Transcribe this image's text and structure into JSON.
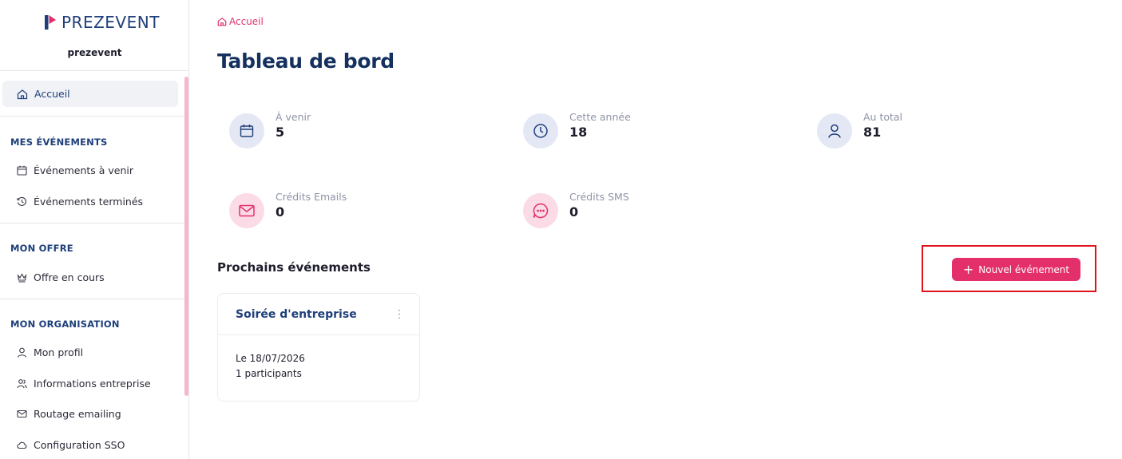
{
  "brand": {
    "name": "PREZEVENT",
    "organization": "prezevent",
    "colors": {
      "navy": "#1e3f7a",
      "accent": "#e3306b"
    }
  },
  "sidebar": {
    "home": {
      "label": "Accueil",
      "icon": "home-icon"
    },
    "sections": [
      {
        "title": "MES ÉVÉNEMENTS",
        "items": [
          {
            "label": "Événements à venir",
            "icon": "calendar-icon"
          },
          {
            "label": "Événements terminés",
            "icon": "history-icon"
          }
        ]
      },
      {
        "title": "MON OFFRE",
        "items": [
          {
            "label": "Offre en cours",
            "icon": "crown-icon"
          }
        ]
      },
      {
        "title": "MON ORGANISATION",
        "items": [
          {
            "label": "Mon profil",
            "icon": "user-icon"
          },
          {
            "label": "Informations entreprise",
            "icon": "users-icon"
          },
          {
            "label": "Routage emailing",
            "icon": "mail-icon"
          },
          {
            "label": "Configuration SSO",
            "icon": "cloud-icon"
          }
        ]
      }
    ]
  },
  "breadcrumb": {
    "label": "Accueil"
  },
  "page": {
    "title": "Tableau de bord"
  },
  "stats": [
    {
      "label": "À venir",
      "value": "5",
      "icon": "calendar-icon"
    },
    {
      "label": "Cette année",
      "value": "18",
      "icon": "clock-icon"
    },
    {
      "label": "Au total",
      "value": "81",
      "icon": "user-icon"
    },
    {
      "label": "Crédits Emails",
      "value": "0",
      "icon": "mail-icon"
    },
    {
      "label": "Crédits SMS",
      "value": "0",
      "icon": "chat-icon"
    }
  ],
  "upcoming": {
    "title": "Prochains événements",
    "new_button": {
      "label": "Nouvel événement",
      "icon": "plus-icon"
    },
    "events": [
      {
        "name": "Soirée d'entreprise",
        "date": "Le 18/07/2026",
        "participants": "1 participants"
      }
    ]
  }
}
